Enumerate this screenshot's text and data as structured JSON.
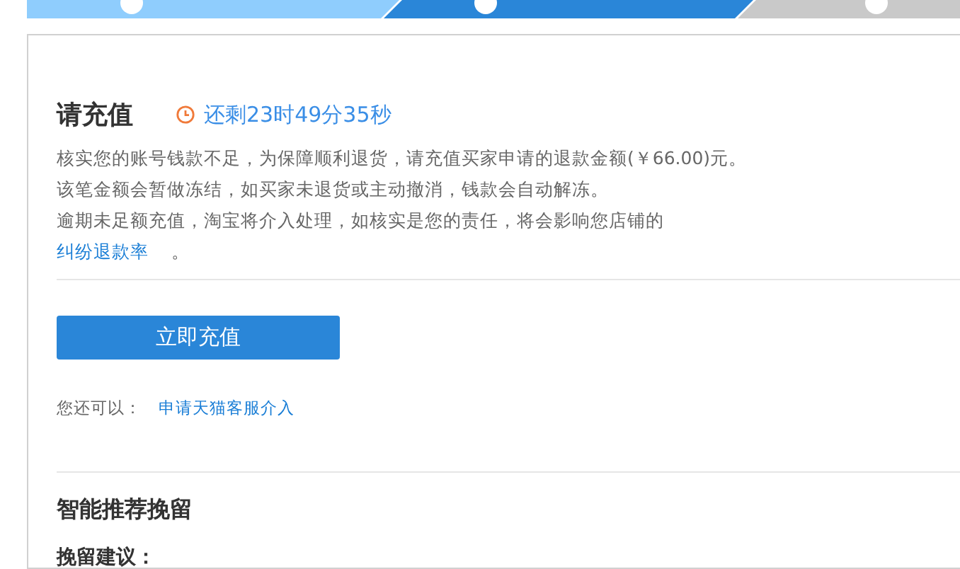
{
  "steps": [
    {
      "completed": true,
      "selected": false
    },
    {
      "selected": true
    },
    {
      "completed": false,
      "selected": false
    }
  ],
  "title": "请充值",
  "countdown": "还剩23时49分35秒",
  "notice": [
    "核实您的账号钱款不足，为保障顺利退货，请充值买家申请的退款金额(￥66.00)元。",
    "该笔金额会暂做冻结，如买家未退货或主动撤消，钱款会自动解冻。",
    "逾期未足额充值，淘宝将介入处理，如核实是您的责任，将会影响您店铺的"
  ],
  "notice_link": "纠纷退款率",
  "notice_end": "。",
  "button": "立即充值",
  "alt_label": "您还可以：",
  "alt_link": "申请天猫客服介入",
  "section_title": "智能推荐挽留",
  "subsection_title": "挽留建议："
}
